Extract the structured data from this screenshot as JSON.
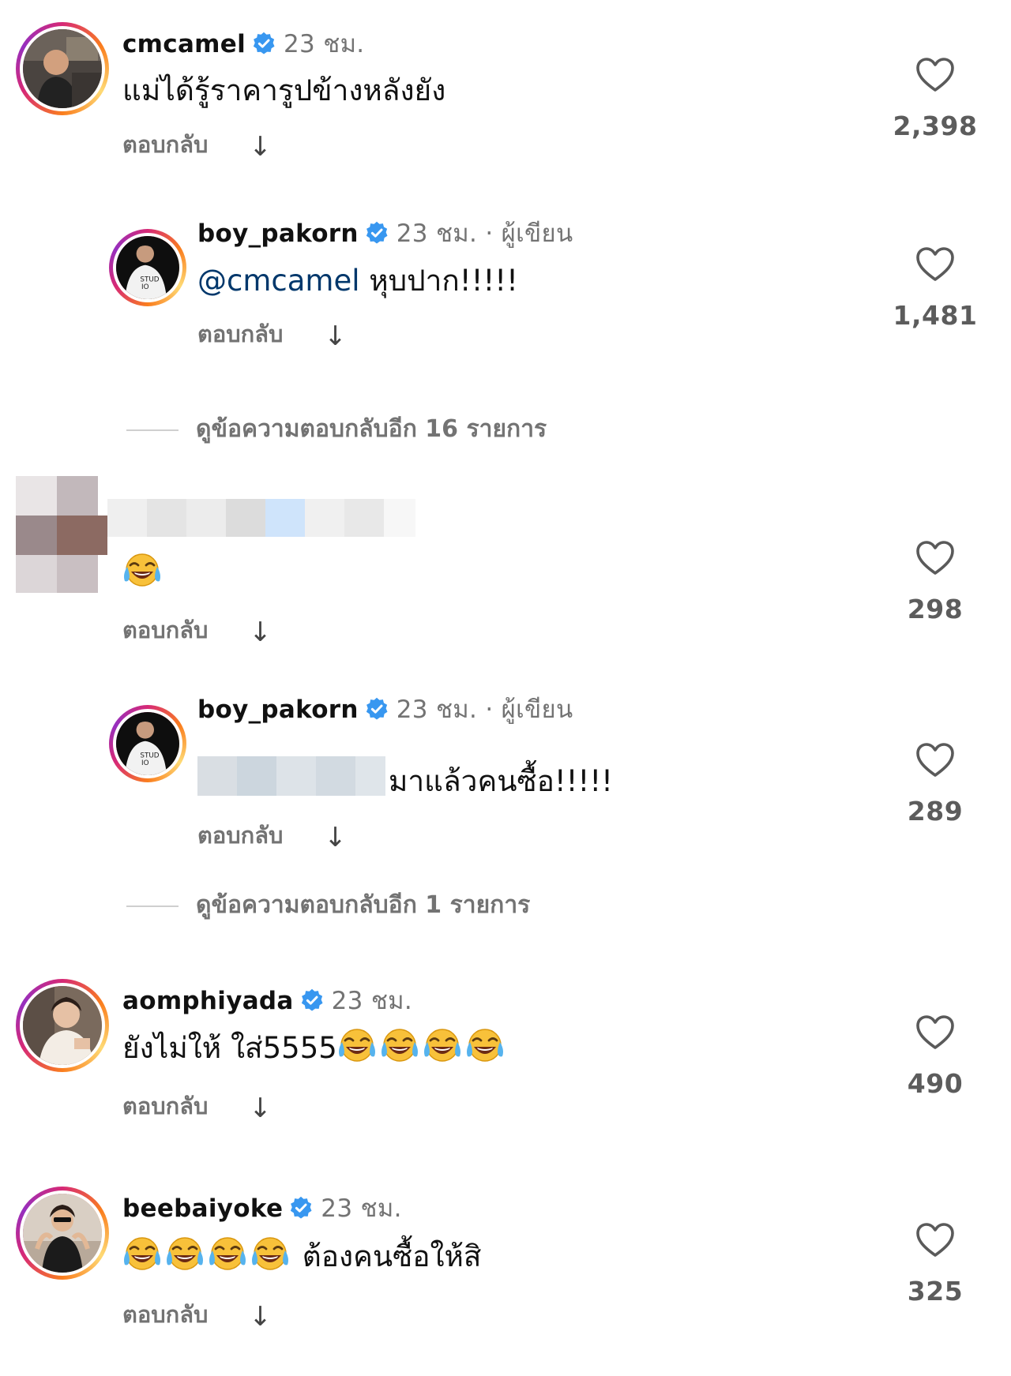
{
  "reply_label": "ตอบกลับ",
  "reply_arrow": "↓",
  "comments": [
    {
      "username": "cmcamel",
      "time": "23 ชม.",
      "text": "แม่ได้รู้ราคารูปข้างหลังยัง",
      "likes": "2,398"
    },
    {
      "username": "boy_pakorn",
      "time": "23 ชม. · ผู้เขียน",
      "mention": "@cmcamel",
      "text": " หุบปาก!!!!!",
      "likes": "1,481"
    },
    {
      "username": "",
      "time": "",
      "text": "",
      "likes": "298"
    },
    {
      "username": "boy_pakorn",
      "time": "23 ชม. · ผู้เขียน",
      "text": "มาแล้วคนซื้อ!!!!!",
      "likes": "289"
    },
    {
      "username": "aomphiyada",
      "time": "23 ชม.",
      "text": "ยังไม่ให้ ใส่5555",
      "likes": "490"
    },
    {
      "username": "beebaiyoke",
      "time": "23 ชม.",
      "text": " ต้องคนซื้อให้สิ",
      "likes": "325"
    }
  ],
  "view_more": [
    "ดูข้อความตอบกลับอีก 16 รายการ",
    "ดูข้อความตอบกลับอีก 1 รายการ"
  ],
  "colors": {
    "verified": "#3897f0",
    "mention": "#00376b",
    "secondary_text": "#737373"
  }
}
